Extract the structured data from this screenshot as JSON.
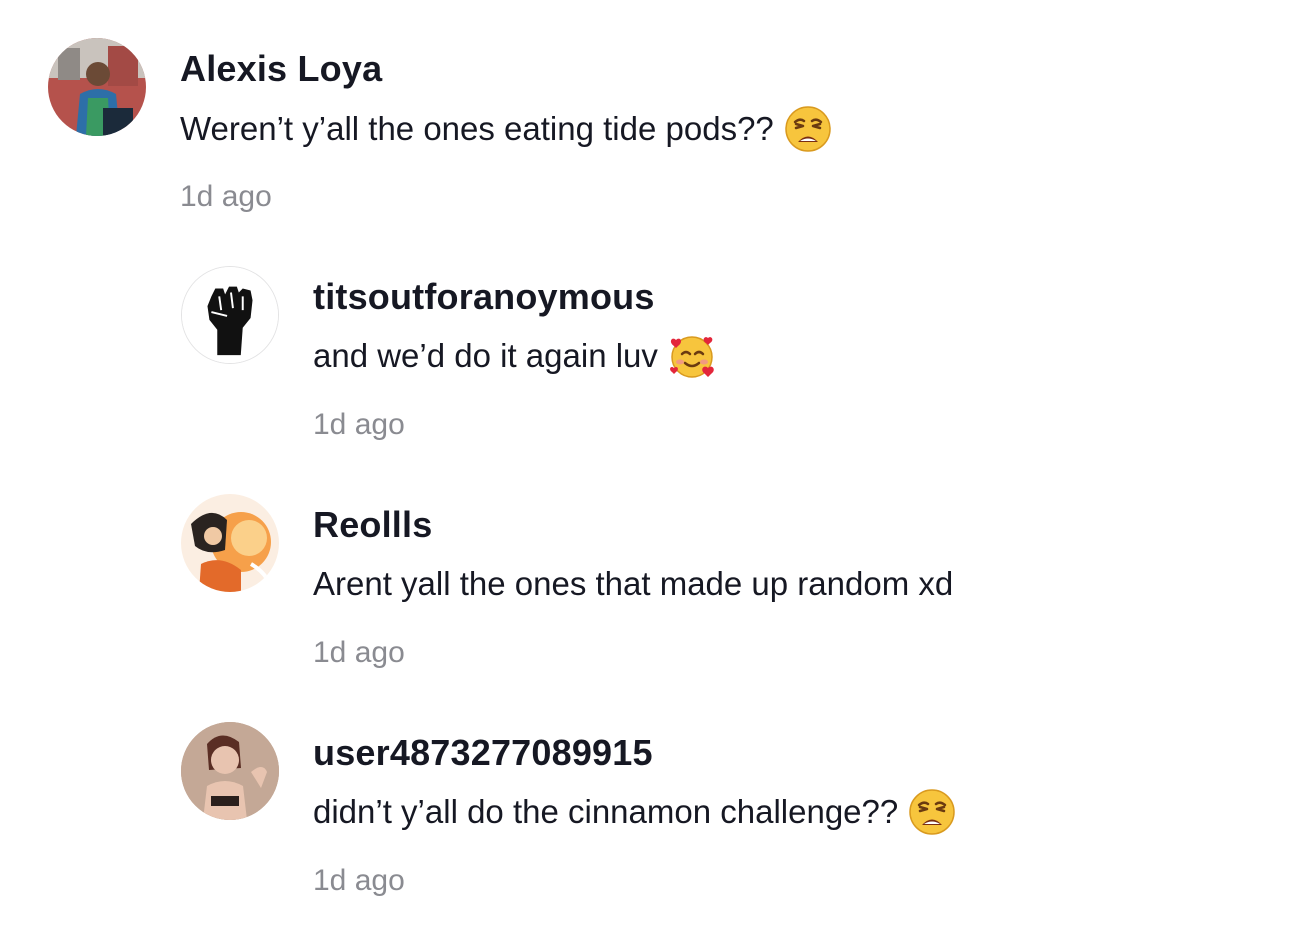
{
  "comments": [
    {
      "username": "Alexis Loya",
      "text": "Weren’t y’all the ones eating tide pods??",
      "emoji": "weary-face-icon",
      "time": "1d ago"
    },
    {
      "username": "titsoutforanoymous",
      "text": "and we’d do it again luv",
      "emoji": "smiling-face-with-hearts-icon",
      "time": "1d ago"
    },
    {
      "username": "Reollls",
      "text": "Arent yall the ones that made up random xd",
      "emoji": "",
      "time": "1d ago"
    },
    {
      "username": "user4873277089915",
      "text": "didn’t y’all do the cinnamon challenge??",
      "emoji": "weary-face-icon",
      "time": "1d ago"
    }
  ],
  "colors": {
    "text": "#161823",
    "timestamp": "#8a8b91",
    "background": "#ffffff"
  }
}
